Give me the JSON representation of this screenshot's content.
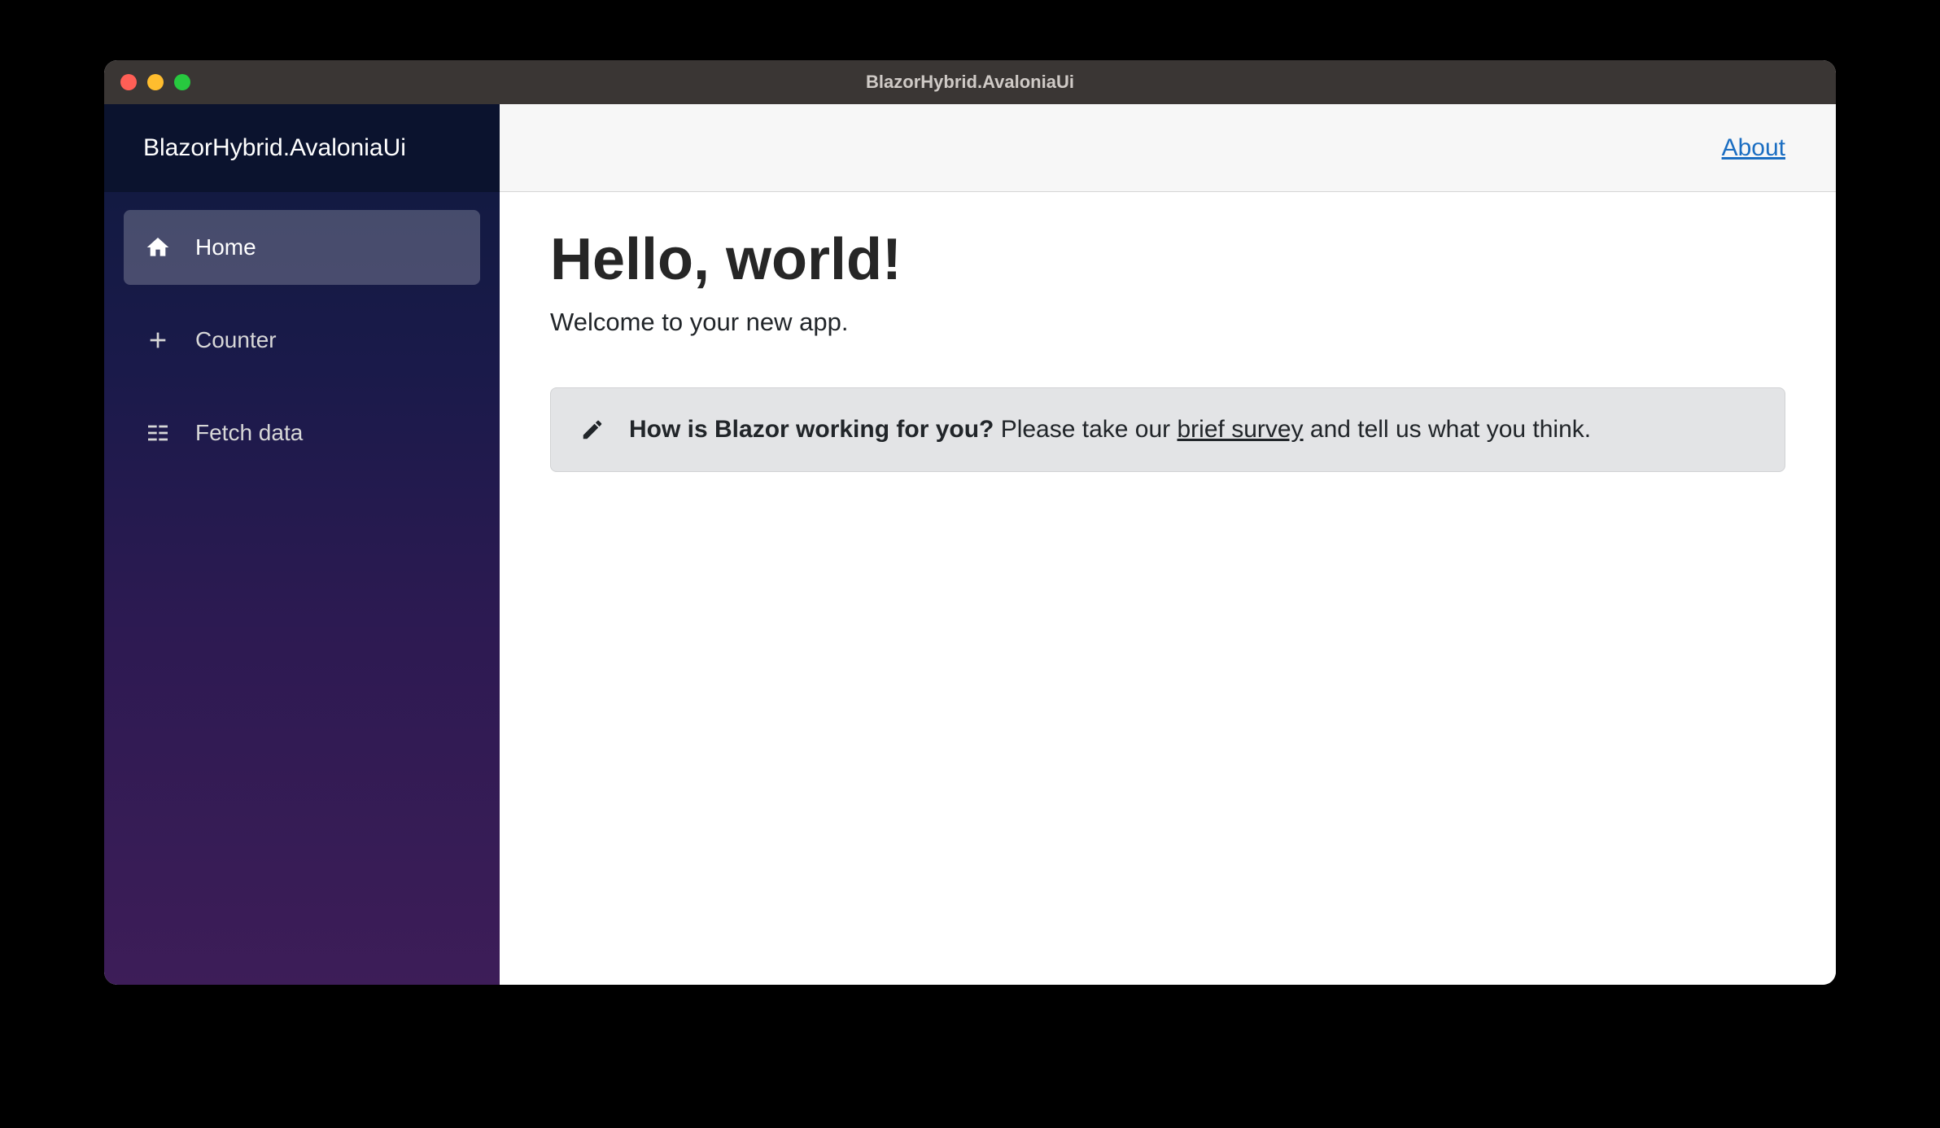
{
  "window": {
    "title": "BlazorHybrid.AvaloniaUi"
  },
  "sidebar": {
    "brand": "BlazorHybrid.AvaloniaUi",
    "items": [
      {
        "label": "Home",
        "icon": "home-icon",
        "active": true
      },
      {
        "label": "Counter",
        "icon": "plus-icon",
        "active": false
      },
      {
        "label": "Fetch data",
        "icon": "list-icon",
        "active": false
      }
    ]
  },
  "top_row": {
    "about_label": "About"
  },
  "page": {
    "title": "Hello, world!",
    "subtitle": "Welcome to your new app.",
    "alert": {
      "question": "How is Blazor working for you?",
      "text_before_link": " Please take our ",
      "link_text": "brief survey",
      "text_after_link": " and tell us what you think."
    }
  }
}
